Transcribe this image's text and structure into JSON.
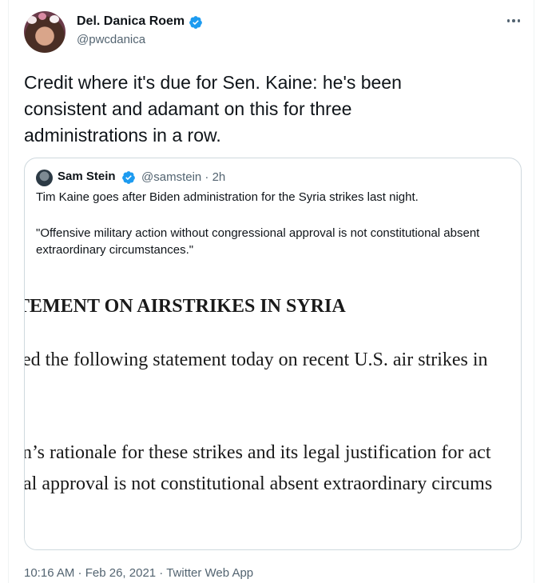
{
  "tweet": {
    "author": {
      "name": "Del. Danica Roem",
      "handle": "@pwcdanica",
      "verified": true
    },
    "text_lines": [
      "Credit where it's due for Sen. Kaine: he's been",
      "consistent and adamant on this for three",
      "administrations in a row."
    ],
    "time": "10:16 AM",
    "separator": " · ",
    "date": "Feb 26, 2021",
    "source": "Twitter Web App"
  },
  "quote": {
    "author": {
      "name": "Sam Stein",
      "handle": "@samstein",
      "age": "· 2h",
      "verified": true
    },
    "text_line1": "Tim Kaine goes after Biden administration for the Syria strikes last night.",
    "text_line2": "\"Offensive military action without congressional approval is not constitutional absent extraordinary circumstances.\"",
    "image_lines": {
      "heading": "TEMENT ON AIRSTRIKES IN SYRIA",
      "line1": "ed the following statement today on recent U.S. air strikes in",
      "line2": "n’s rationale for these strikes and its legal justification for act",
      "line3": "al approval is not constitutional absent extraordinary circums"
    }
  },
  "colors": {
    "text": "#0f1419",
    "secondary": "#536471",
    "verified": "#1d9bf0",
    "border": "#cfd9de"
  },
  "icons": {
    "verified": "verified-badge-icon",
    "more": "more-dots-icon"
  }
}
